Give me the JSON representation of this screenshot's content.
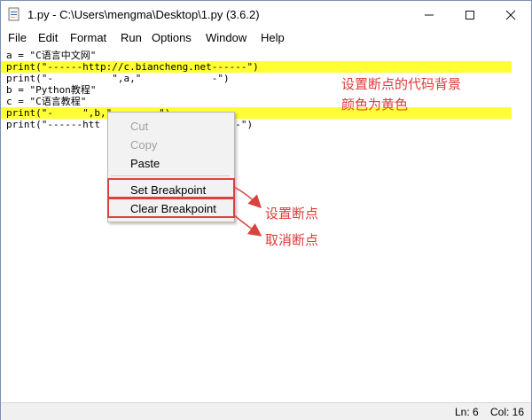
{
  "window": {
    "title": "1.py - C:\\Users\\mengma\\Desktop\\1.py (3.6.2)"
  },
  "menubar": {
    "items": [
      "File",
      "Edit",
      "Format",
      "Run",
      "Options",
      "Window",
      "Help"
    ]
  },
  "editor": {
    "lines": [
      {
        "text": "a = \"C语言中文网\"",
        "highlight": false
      },
      {
        "text": "print(\"------http://c.biancheng.net------\")",
        "highlight": true
      },
      {
        "text": "print(\"-          \",a,\"            -\")",
        "highlight": false
      },
      {
        "text": "b = \"Python教程\"",
        "highlight": false
      },
      {
        "text": "c = \"C语言教程\"",
        "highlight": false
      },
      {
        "text": "print(\"-     \",b,\"        \")",
        "highlight": true
      },
      {
        "text": "print(\"------htt                  ------\")",
        "highlight": false
      }
    ]
  },
  "annotations": {
    "bg_note_line1": "设置断点的代码背景",
    "bg_note_line2": "颜色为黄色",
    "set_note": "设置断点",
    "clear_note": "取消断点"
  },
  "context_menu": {
    "cut": "Cut",
    "copy": "Copy",
    "paste": "Paste",
    "set_breakpoint": "Set Breakpoint",
    "clear_breakpoint": "Clear Breakpoint"
  },
  "statusbar": {
    "line": "Ln: 6",
    "col": "Col: 16"
  },
  "colors": {
    "breakpoint_bg": "#ffff33",
    "annotation": "#e03a3a",
    "keyword": "#900090",
    "string": "#00a000"
  }
}
